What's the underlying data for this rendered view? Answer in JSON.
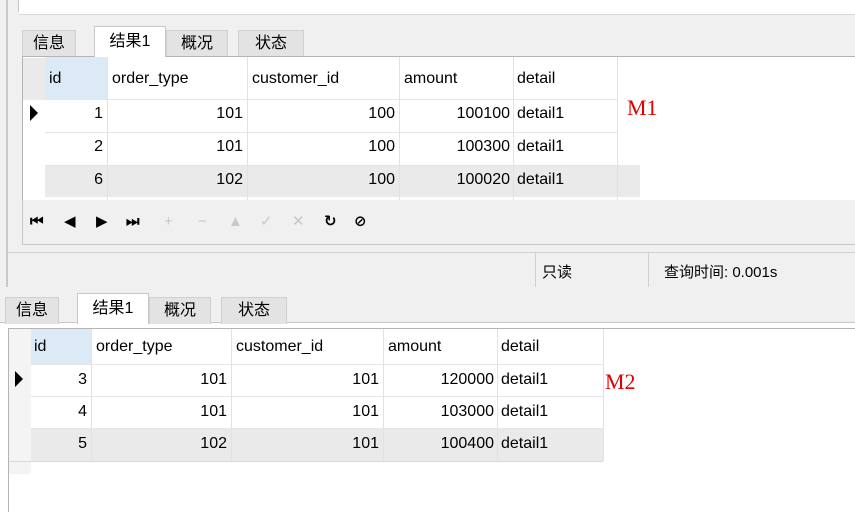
{
  "panel1": {
    "tabs": [
      "信息",
      "结果1",
      "概况",
      "状态"
    ],
    "columns": [
      "id",
      "order_type",
      "customer_id",
      "amount",
      "detail"
    ],
    "rows": [
      [
        "1",
        "101",
        "100",
        "100100",
        "detail1"
      ],
      [
        "2",
        "101",
        "100",
        "100300",
        "detail1"
      ],
      [
        "6",
        "102",
        "100",
        "100020",
        "detail1"
      ]
    ],
    "label": "M1",
    "toolbar": [
      "⏮",
      "◀",
      "▶",
      "⏭",
      "+",
      "−",
      "▲",
      "✓",
      "✕",
      "↻",
      "⊘"
    ],
    "status": {
      "readonly": "只读",
      "query_time": "查询时间: 0.001s"
    }
  },
  "panel2": {
    "tabs": [
      "信息",
      "结果1",
      "概况",
      "状态"
    ],
    "columns": [
      "id",
      "order_type",
      "customer_id",
      "amount",
      "detail"
    ],
    "rows": [
      [
        "3",
        "101",
        "101",
        "120000",
        "detail1"
      ],
      [
        "4",
        "101",
        "101",
        "103000",
        "detail1"
      ],
      [
        "5",
        "102",
        "101",
        "100400",
        "detail1"
      ]
    ],
    "label": "M2"
  },
  "colors": {
    "label": "#e00000",
    "selected_row": "#eaeaea",
    "panel_bg": "#f0f0f0"
  }
}
